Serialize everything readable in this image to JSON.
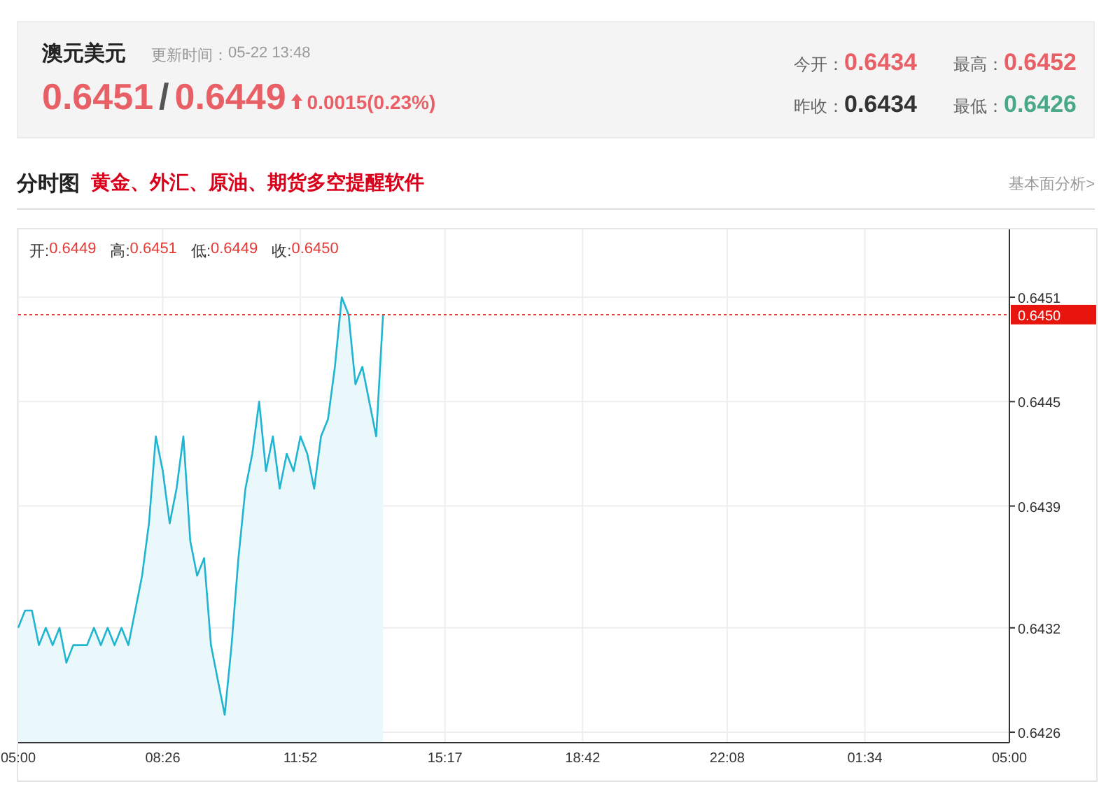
{
  "quote": {
    "name": "澳元美元",
    "update_label": "更新时间：",
    "update_time": "05-22 13:48",
    "bid": "0.6451",
    "separator": "/",
    "ask": "0.6449",
    "rising": true,
    "color": "#e85f66",
    "change": "0.0015(0.23%)",
    "stats": [
      {
        "label": "今开：",
        "value": "0.6434",
        "color": "#e85f66"
      },
      {
        "label": "最高：",
        "value": "0.6452",
        "color": "#e85f66"
      },
      {
        "label": "昨收：",
        "value": "0.6434",
        "color": "#333333"
      },
      {
        "label": "最低：",
        "value": "0.6426",
        "color": "#4aa88a"
      }
    ]
  },
  "section": {
    "title": "分时图",
    "promo_link": "黄金、外汇、原油、期货多空提醒软件",
    "more_link": "基本面分析>"
  },
  "chart": {
    "info": [
      {
        "label": "开:",
        "value": "0.6449"
      },
      {
        "label": "高:",
        "value": "0.6451"
      },
      {
        "label": "低:",
        "value": "0.6449"
      },
      {
        "label": "收:",
        "value": "0.6450"
      }
    ],
    "chart_data": {
      "type": "line",
      "grid": true,
      "categories": [
        "05:00",
        null,
        null,
        null,
        null,
        null,
        null,
        null,
        null,
        null,
        null,
        null,
        null,
        null,
        null,
        null,
        null,
        null,
        null,
        null,
        null,
        "08:26",
        null,
        null,
        null,
        null,
        null,
        null,
        null,
        null,
        null,
        null,
        null,
        null,
        null,
        null,
        null,
        null,
        null,
        null,
        null,
        "11:52",
        null,
        null,
        null,
        null,
        null,
        null,
        null,
        null,
        null,
        null,
        null,
        null,
        null,
        null,
        null,
        null,
        null,
        null,
        null,
        null,
        "15:17",
        null,
        null,
        null,
        null,
        null,
        null,
        null,
        null,
        null,
        null,
        null,
        null,
        null,
        null,
        null,
        null,
        null,
        null,
        null,
        "18:42",
        null,
        null,
        null,
        null,
        null,
        null,
        null,
        null,
        null,
        null,
        null,
        null,
        null,
        null,
        null,
        null,
        null,
        null,
        null,
        null,
        "22:08",
        null,
        null,
        null,
        null,
        null,
        null,
        null,
        null,
        null,
        null,
        null,
        null,
        null,
        null,
        null,
        null,
        null,
        null,
        null,
        "01:34",
        null,
        null,
        null,
        null,
        null,
        null,
        null,
        null,
        null,
        null,
        null,
        null,
        null,
        null,
        null,
        null,
        null,
        null,
        null,
        null,
        "05:00"
      ],
      "series": [
        {
          "color": "#1fb5d0",
          "values": [
            0.6432,
            0.6433,
            0.6433,
            0.6431,
            0.6432,
            0.6431,
            0.6432,
            0.643,
            0.6431,
            0.6431,
            0.6431,
            0.6432,
            0.6431,
            0.6432,
            0.6431,
            0.6432,
            0.6431,
            0.6433,
            0.6435,
            0.6438,
            0.6443,
            0.6441,
            0.6438,
            0.644,
            0.6443,
            0.6437,
            0.6435,
            0.6436,
            0.6431,
            0.6429,
            0.6427,
            0.6431,
            0.6436,
            0.644,
            0.6442,
            0.6445,
            0.6441,
            0.6443,
            0.644,
            0.6442,
            0.6441,
            0.6443,
            0.6442,
            0.644,
            0.6443,
            0.6444,
            0.6447,
            0.6451,
            0.645,
            0.6446,
            0.6447,
            0.6445,
            0.6443,
            0.645,
            null,
            null,
            null,
            null,
            null,
            null,
            null,
            null,
            null,
            null,
            null,
            null,
            null,
            null,
            null,
            null,
            null,
            null,
            null,
            null,
            null,
            null,
            null,
            null,
            null,
            null,
            null,
            null,
            null,
            null,
            null,
            null,
            null,
            null,
            null,
            null,
            null,
            null,
            null,
            null,
            null,
            null,
            null,
            null,
            null,
            null,
            null,
            null,
            null,
            null,
            null,
            null,
            null,
            null,
            null,
            null,
            null,
            null,
            null,
            null,
            null,
            null,
            null,
            null,
            null,
            null,
            null,
            null,
            null,
            null,
            null,
            null,
            null,
            null,
            null,
            null,
            null,
            null,
            null,
            null,
            null,
            null,
            null,
            null,
            null,
            null,
            null,
            null,
            null,
            null,
            null
          ]
        }
      ],
      "ylim": [
        0.64254,
        0.64549
      ],
      "ref_lines": [
        {
          "axis": "y",
          "value": 0.645,
          "label": "0.6450",
          "color": "#e53935"
        }
      ],
      "yticks": [
        {
          "value": 0.6451,
          "label": "0.6451"
        },
        {
          "value": 0.6445,
          "label": "0.6445"
        },
        {
          "value": 0.6439,
          "label": "0.6439"
        },
        {
          "value": 0.6432,
          "label": "0.6432"
        },
        {
          "value": 0.6426,
          "label": "0.6426"
        }
      ]
    }
  }
}
